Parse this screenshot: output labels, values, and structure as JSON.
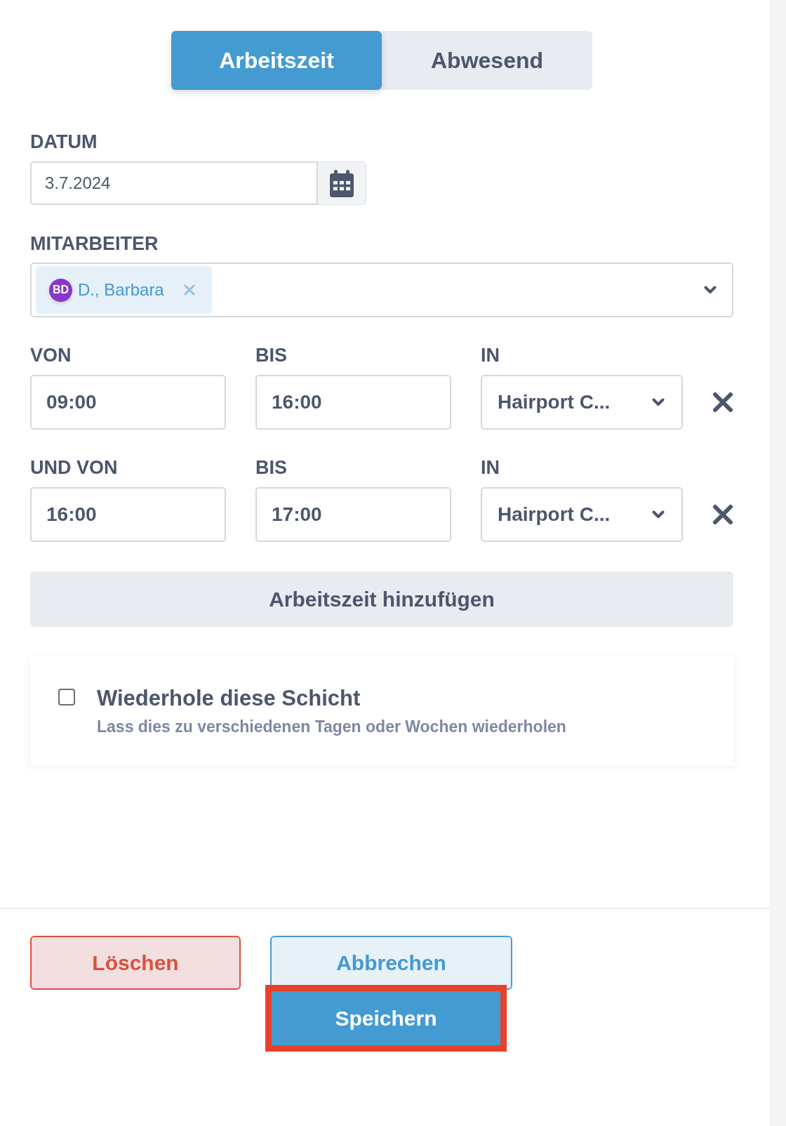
{
  "tabs": [
    {
      "label": "Arbeitszeit",
      "selected": true
    },
    {
      "label": "Abwesend",
      "selected": false
    }
  ],
  "date": {
    "label": "DATUM",
    "value": "3.7.2024"
  },
  "employees": {
    "label": "MITARBEITER",
    "chips": [
      {
        "initials": "BD",
        "name": "D., Barbara",
        "color": "#8b35c9"
      }
    ]
  },
  "shifts": [
    {
      "from_label": "VON",
      "from": "09:00",
      "to_label": "BIS",
      "to": "16:00",
      "location_label": "IN",
      "location": "Hairport C..."
    },
    {
      "from_label": "UND VON",
      "from": "16:00",
      "to_label": "BIS",
      "to": "17:00",
      "location_label": "IN",
      "location": "Hairport C..."
    }
  ],
  "add_button": "Arbeitszeit hinzufügen",
  "repeat": {
    "title": "Wiederhole diese Schicht",
    "subtitle": "Lass dies zu verschiedenen Tagen oder Wochen wiederholen",
    "checked": false
  },
  "actions": [
    {
      "label": "Löschen",
      "kind": "danger",
      "highlighted": false
    },
    {
      "label": "Abbrechen",
      "kind": "secondary",
      "highlighted": false
    },
    {
      "label": "Speichern",
      "kind": "primary",
      "highlighted": true
    }
  ]
}
